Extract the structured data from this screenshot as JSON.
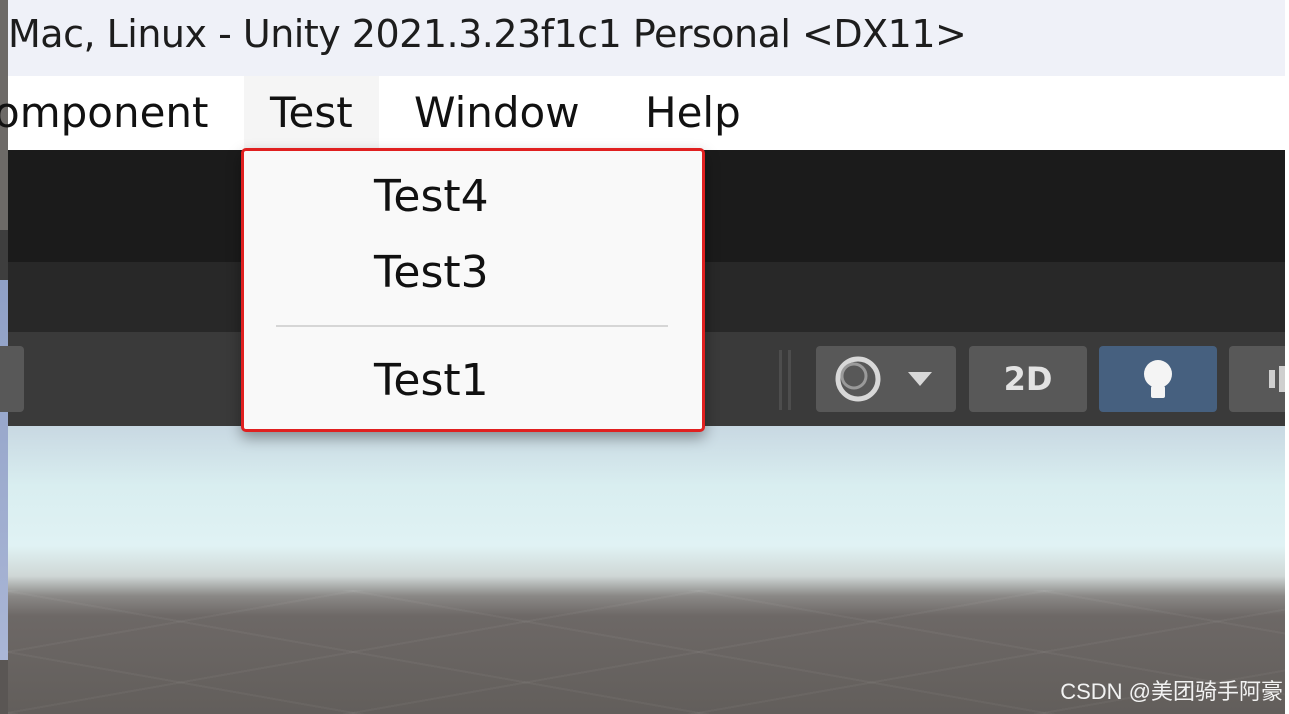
{
  "window": {
    "title": "Mac, Linux - Unity 2021.3.23f1c1 Personal <DX11>"
  },
  "menu_bar": {
    "items": [
      {
        "label": "omponent"
      },
      {
        "label": "Test"
      },
      {
        "label": "Window"
      },
      {
        "label": "Help"
      }
    ]
  },
  "dropdown": {
    "items": [
      {
        "label": "Test4"
      },
      {
        "label": "Test3"
      },
      {
        "label": "Test1"
      }
    ]
  },
  "scene_toolbar": {
    "btn_2d_label": "2D",
    "shading_icon": "circle-icon",
    "lighting_icon": "lightbulb-icon",
    "active_color": "#46607f"
  },
  "watermark": "CSDN @美团骑手阿豪"
}
